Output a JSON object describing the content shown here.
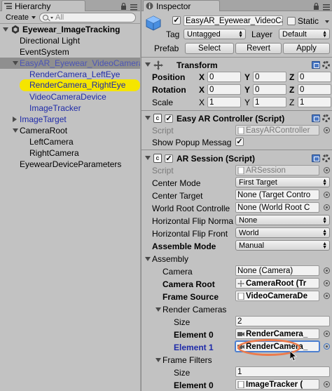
{
  "hierarchy": {
    "tab_label": "Hierarchy",
    "create_label": "Create",
    "search_placeholder": "All",
    "scene": "Eyewear_ImageTracking",
    "items": [
      {
        "label": "Directional Light"
      },
      {
        "label": "EventSystem"
      },
      {
        "label": "EasyAR_Eyewear_VideoCamera"
      },
      {
        "label": "RenderCamera_LeftEye"
      },
      {
        "label": "RenderCamera_RightEye"
      },
      {
        "label": "VideoCameraDevice"
      },
      {
        "label": "ImageTracker"
      },
      {
        "label": "ImageTarget"
      },
      {
        "label": "CameraRoot"
      },
      {
        "label": "LeftCamera"
      },
      {
        "label": "RightCamera"
      },
      {
        "label": "EyewearDeviceParameters"
      }
    ]
  },
  "inspector": {
    "tab_label": "Inspector",
    "object_name": "EasyAR_Eyewear_VideoCamera",
    "static_label": "Static",
    "tag_label": "Tag",
    "tag_value": "Untagged",
    "layer_label": "Layer",
    "layer_value": "Default",
    "prefab_label": "Prefab",
    "prefab_buttons": [
      "Select",
      "Revert",
      "Apply"
    ],
    "transform": {
      "title": "Transform",
      "rows": [
        {
          "label": "Position",
          "x": "0",
          "y": "0",
          "z": "0"
        },
        {
          "label": "Rotation",
          "x": "0",
          "y": "0",
          "z": "0"
        },
        {
          "label": "Scale",
          "x": "1",
          "y": "1",
          "z": "1"
        }
      ],
      "axis_x": "X",
      "axis_y": "Y",
      "axis_z": "Z"
    },
    "controller": {
      "title": "Easy AR Controller (Script)",
      "script_label": "Script",
      "script_value": "EasyARController",
      "popup_label": "Show Popup Messag"
    },
    "session": {
      "title": "AR Session (Script)",
      "script_label": "Script",
      "script_value": "ARSession",
      "center_mode_label": "Center Mode",
      "center_mode_value": "First Target",
      "center_target_label": "Center Target",
      "center_target_value": "None (Target Contro",
      "world_root_label": "World Root Controlle",
      "world_root_value": "None (World Root C",
      "hflip_normal_label": "Horizontal Flip Norma",
      "hflip_normal_value": "None",
      "hflip_front_label": "Horizontal Flip Front",
      "hflip_front_value": "World",
      "assemble_mode_label": "Assemble Mode",
      "assemble_mode_value": "Manual",
      "assembly_label": "Assembly",
      "camera_label": "Camera",
      "camera_value": "None (Camera)",
      "camera_root_label": "Camera Root",
      "camera_root_value": "CameraRoot (Tr",
      "frame_source_label": "Frame Source",
      "frame_source_value": "VideoCameraDe",
      "render_cameras_label": "Render Cameras",
      "size_label": "Size",
      "render_size": "2",
      "element0_label": "Element 0",
      "element0_value": "RenderCamera_",
      "element1_label": "Element 1",
      "element1_value": "RenderCamera_",
      "frame_filters_label": "Frame Filters",
      "filters_size": "1",
      "filter0_label": "Element 0",
      "filter0_value": "ImageTracker ("
    }
  },
  "colors": {
    "highlight": "#f5e500",
    "annotation_ring": "#ec7a4b",
    "modified_label": "#1e2aa8"
  }
}
